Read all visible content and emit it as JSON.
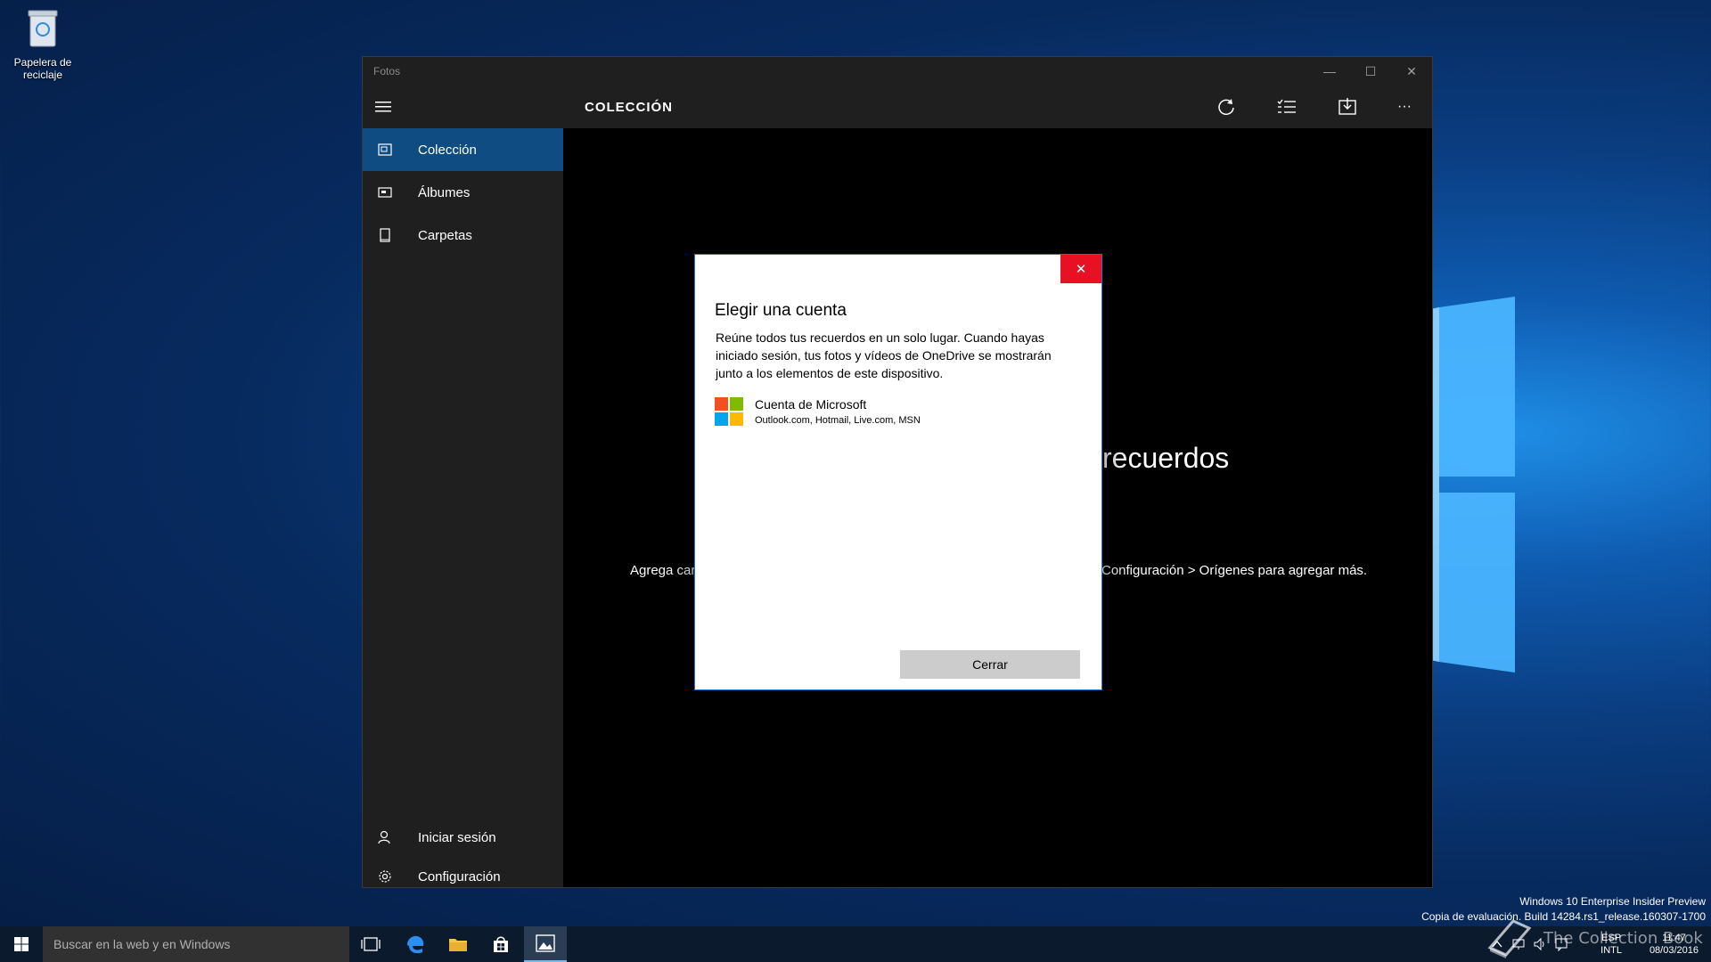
{
  "desktop": {
    "recycle_bin_label": "Papelera de reciclaje"
  },
  "window": {
    "title": "Fotos",
    "minimize_glyph": "—",
    "maximize_glyph": "☐",
    "close_glyph": "✕"
  },
  "sidebar": {
    "items": [
      {
        "label": "Colección",
        "icon": "collection-icon",
        "active": true
      },
      {
        "label": "Álbumes",
        "icon": "albums-icon",
        "active": false
      },
      {
        "label": "Carpetas",
        "icon": "folders-icon",
        "active": false
      }
    ],
    "bottom_items": [
      {
        "label": "Iniciar sesión",
        "icon": "person-icon"
      },
      {
        "label": "Configuración",
        "icon": "gear-icon"
      }
    ]
  },
  "content": {
    "page_title": "COLECCIÓN",
    "commands": [
      "refresh-icon",
      "select-icon",
      "import-icon",
      "more-icon"
    ],
    "more_glyph": "···",
    "empty_heading": "recuerdos",
    "empty_text_left": "Agrega car",
    "empty_text_right": "Configuración > Orígenes para agregar más."
  },
  "dialog": {
    "title": "Elegir una cuenta",
    "body": "Reúne todos tus recuerdos en un solo lugar. Cuando hayas iniciado sesión, tus fotos y vídeos de OneDrive se mostrarán junto a los elementos de este dispositivo.",
    "account_name": "Cuenta de Microsoft",
    "account_sub": "Outlook.com, Hotmail, Live.com, MSN",
    "close_button": "Cerrar",
    "close_glyph": "✕"
  },
  "watermark": {
    "line1": "Windows 10 Enterprise Insider Preview",
    "line2": "Copia de evaluación. Build 14284.rs1_release.160307-1700"
  },
  "taskbar": {
    "search_placeholder": "Buscar en la web y en Windows",
    "lang_line1": "ESP",
    "lang_line2": "INTL",
    "time": "11:47",
    "date": "08/03/2016",
    "overlay_text": "The Collection Book"
  },
  "colors": {
    "accent": "#0f4c81",
    "dialog_close": "#e81123",
    "chrome": "#1f1f1f"
  }
}
